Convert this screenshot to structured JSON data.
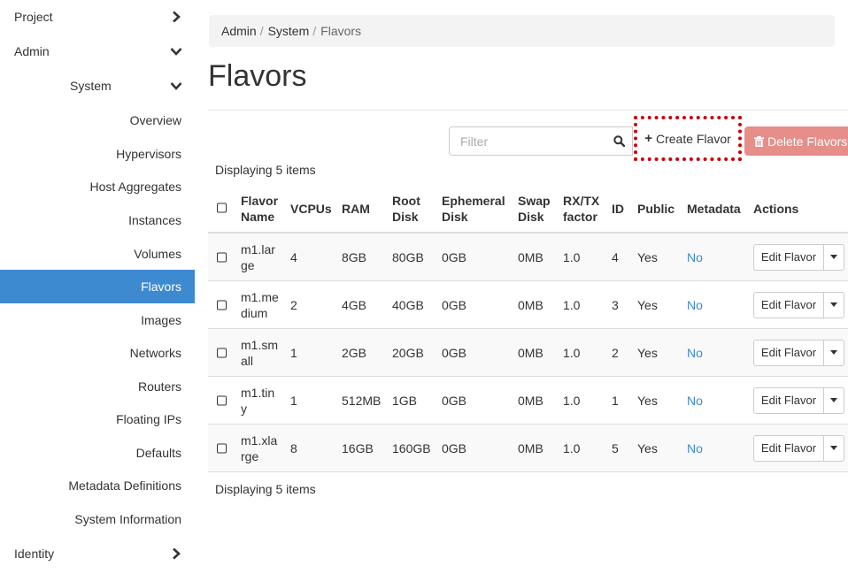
{
  "sidebar": {
    "project": "Project",
    "admin": "Admin",
    "system": "System",
    "items": [
      {
        "label": "Overview"
      },
      {
        "label": "Hypervisors"
      },
      {
        "label": "Host Aggregates"
      },
      {
        "label": "Instances"
      },
      {
        "label": "Volumes"
      },
      {
        "label": "Flavors"
      },
      {
        "label": "Images"
      },
      {
        "label": "Networks"
      },
      {
        "label": "Routers"
      },
      {
        "label": "Floating IPs"
      },
      {
        "label": "Defaults"
      },
      {
        "label": "Metadata Definitions"
      },
      {
        "label": "System Information"
      }
    ],
    "active_item": "Flavors",
    "identity": "Identity"
  },
  "breadcrumb": [
    "Admin",
    "System",
    "Flavors"
  ],
  "page_title": "Flavors",
  "toolbar": {
    "filter_placeholder": "Filter",
    "create_label": "Create Flavor",
    "delete_label": "Delete Flavors"
  },
  "count_text": "Displaying 5 items",
  "table": {
    "headers": {
      "name": [
        "Flavor",
        "Name"
      ],
      "vcpus": "VCPUs",
      "ram": "RAM",
      "root": [
        "Root",
        "Disk"
      ],
      "ephemeral": [
        "Ephemeral",
        "Disk"
      ],
      "swap": [
        "Swap",
        "Disk"
      ],
      "rxtx": [
        "RX/TX",
        "factor"
      ],
      "id": "ID",
      "public": "Public",
      "metadata": "Metadata",
      "actions": "Actions"
    },
    "rows": [
      {
        "name": [
          "m1.lar",
          "ge"
        ],
        "vcpus": "4",
        "ram": "8GB",
        "root": "80GB",
        "ephemeral": "0GB",
        "swap": "0MB",
        "rxtx": "1.0",
        "id": "4",
        "public": "Yes",
        "metadata": "No",
        "action": "Edit Flavor"
      },
      {
        "name": [
          "m1.me",
          "dium"
        ],
        "vcpus": "2",
        "ram": "4GB",
        "root": "40GB",
        "ephemeral": "0GB",
        "swap": "0MB",
        "rxtx": "1.0",
        "id": "3",
        "public": "Yes",
        "metadata": "No",
        "action": "Edit Flavor"
      },
      {
        "name": [
          "m1.sm",
          "all"
        ],
        "vcpus": "1",
        "ram": "2GB",
        "root": "20GB",
        "ephemeral": "0GB",
        "swap": "0MB",
        "rxtx": "1.0",
        "id": "2",
        "public": "Yes",
        "metadata": "No",
        "action": "Edit Flavor"
      },
      {
        "name": [
          "m1.tin",
          "y"
        ],
        "vcpus": "1",
        "ram": "512MB",
        "root": "1GB",
        "ephemeral": "0GB",
        "swap": "0MB",
        "rxtx": "1.0",
        "id": "1",
        "public": "Yes",
        "metadata": "No",
        "action": "Edit Flavor"
      },
      {
        "name": [
          "m1.xla",
          "rge"
        ],
        "vcpus": "8",
        "ram": "16GB",
        "root": "160GB",
        "ephemeral": "0GB",
        "swap": "0MB",
        "rxtx": "1.0",
        "id": "5",
        "public": "Yes",
        "metadata": "No",
        "action": "Edit Flavor"
      }
    ]
  },
  "colors": {
    "active_nav": "#3e8ad0",
    "link": "#3e8ad0",
    "delete_button": "#e58e8a",
    "highlight_border": "#c8000a"
  },
  "icons": {
    "chevron_right": "chevron-right-icon",
    "chevron_down": "chevron-down-icon",
    "search": "search-icon",
    "plus": "plus-icon",
    "trash": "trash-icon",
    "caret": "caret-down-icon"
  }
}
